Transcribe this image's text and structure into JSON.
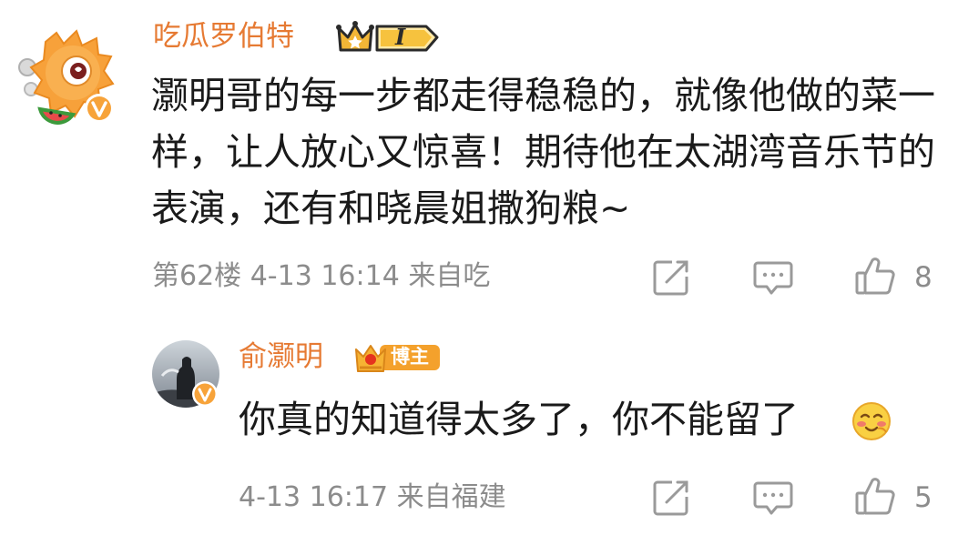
{
  "comment": {
    "username": "吃瓜罗伯特",
    "fan_badge_level": "I",
    "text": "灏明哥的每一步都走得稳稳的，就像他做的菜一样，让人放心又惊喜！期待他在太湖湾音乐节的表演，还有和晓晨姐撒狗粮~",
    "meta": "第62楼 4-13 16:14 来自吃",
    "like_count": "8",
    "avatar_icon": "cartoon-mascot-avatar",
    "verified_icon": "orange-v-badge"
  },
  "reply": {
    "username": "俞灏明",
    "host_badge": "博主",
    "text": "你真的知道得太多了，你不能留了",
    "emoji_icon": "blushing-smile-emoji",
    "meta": "4-13 16:17 来自福建",
    "like_count": "5",
    "avatar_icon": "photo-avatar",
    "verified_icon": "orange-v-badge"
  },
  "colors": {
    "username": "#e67a33",
    "text": "#1a1a1a",
    "meta": "#8c8c8c",
    "icon": "#9a9a9a"
  }
}
